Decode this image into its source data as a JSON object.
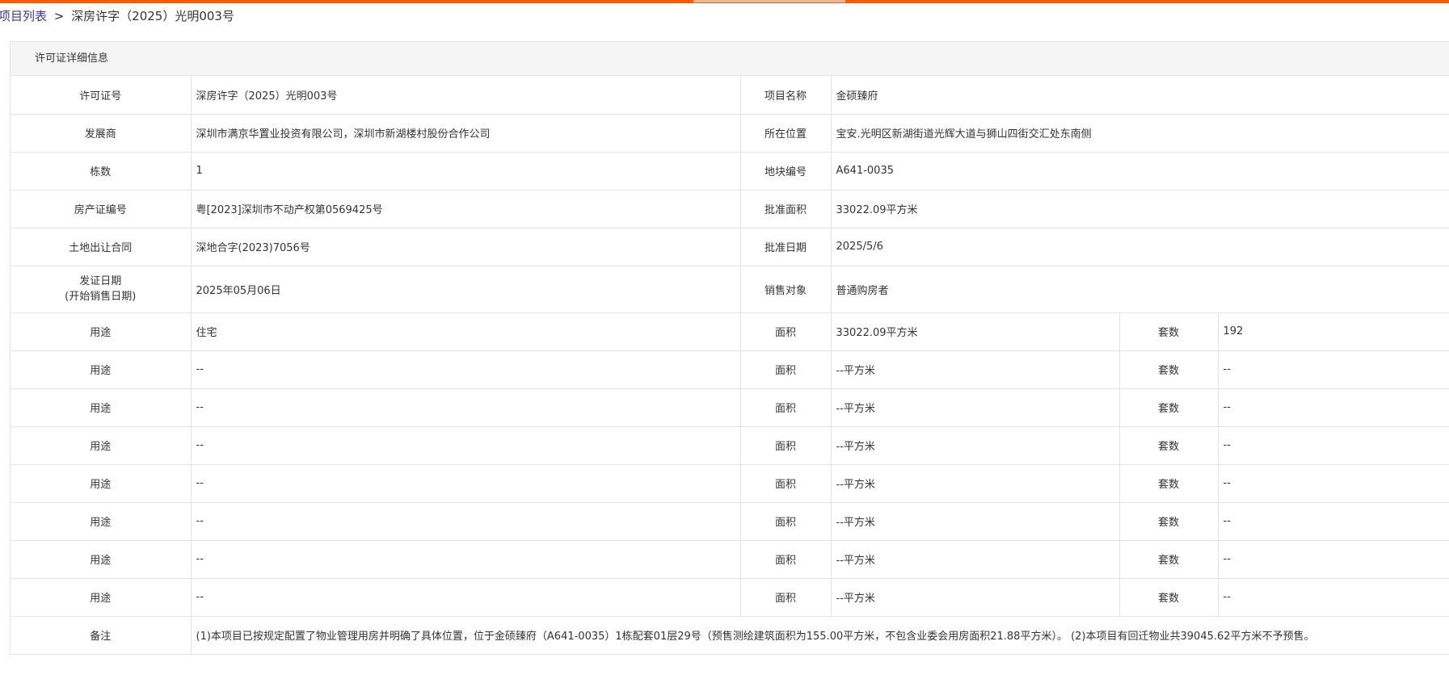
{
  "breadcrumb": {
    "link": "项目列表",
    "separator": ">",
    "current": "深房许字（2025）光明003号"
  },
  "panel": {
    "title": "许可证详细信息"
  },
  "details": {
    "permit_no": {
      "label": "许可证号",
      "value": "深房许字（2025）光明003号"
    },
    "project_name": {
      "label": "项目名称",
      "value": "金硕臻府"
    },
    "developer": {
      "label": "发展商",
      "value": "深圳市满京华置业投资有限公司，深圳市新湖楼村股份合作公司"
    },
    "location": {
      "label": "所在位置",
      "value": "宝安.光明区新湖街道光辉大道与狮山四街交汇处东南侧"
    },
    "buildings": {
      "label": "栋数",
      "value": "1"
    },
    "plot_no": {
      "label": "地块编号",
      "value": "A641-0035"
    },
    "property_cert": {
      "label": "房产证编号",
      "value": "粤[2023]深圳市不动产权第0569425号"
    },
    "approved_area": {
      "label": "批准面积",
      "value": "33022.09平方米"
    },
    "land_contract": {
      "label": "土地出让合同",
      "value": "深地合字(2023)7056号"
    },
    "approval_date": {
      "label": "批准日期",
      "value": "2025/5/6"
    },
    "issue_date": {
      "label_line1": "发证日期",
      "label_line2": "(开始销售日期)",
      "value": "2025年05月06日"
    },
    "sales_target": {
      "label": "销售对象",
      "value": "普通购房者"
    }
  },
  "usage_rows": [
    {
      "usage_label": "用途",
      "usage": "住宅",
      "area_label": "面积",
      "area": "33022.09平方米",
      "units_label": "套数",
      "units": "192"
    },
    {
      "usage_label": "用途",
      "usage": "--",
      "area_label": "面积",
      "area": "--平方米",
      "units_label": "套数",
      "units": "--"
    },
    {
      "usage_label": "用途",
      "usage": "--",
      "area_label": "面积",
      "area": "--平方米",
      "units_label": "套数",
      "units": "--"
    },
    {
      "usage_label": "用途",
      "usage": "--",
      "area_label": "面积",
      "area": "--平方米",
      "units_label": "套数",
      "units": "--"
    },
    {
      "usage_label": "用途",
      "usage": "--",
      "area_label": "面积",
      "area": "--平方米",
      "units_label": "套数",
      "units": "--"
    },
    {
      "usage_label": "用途",
      "usage": "--",
      "area_label": "面积",
      "area": "--平方米",
      "units_label": "套数",
      "units": "--"
    },
    {
      "usage_label": "用途",
      "usage": "--",
      "area_label": "面积",
      "area": "--平方米",
      "units_label": "套数",
      "units": "--"
    },
    {
      "usage_label": "用途",
      "usage": "--",
      "area_label": "面积",
      "area": "--平方米",
      "units_label": "套数",
      "units": "--"
    }
  ],
  "remarks": {
    "label": "备注",
    "value": "(1)本项目已按规定配置了物业管理用房并明确了具体位置，位于金硕臻府（A641-0035）1栋配套01层29号（预售测绘建筑面积为155.00平方米，不包含业委会用房面积21.88平方米）。 (2)本项目有回迁物业共39045.62平方米不予预售。"
  },
  "colors": {
    "accent_bar": "#ff5a0a",
    "border": "#e3e3e3",
    "header_bg": "#f5f5f5",
    "breadcrumb_link": "#3a3a8c"
  }
}
